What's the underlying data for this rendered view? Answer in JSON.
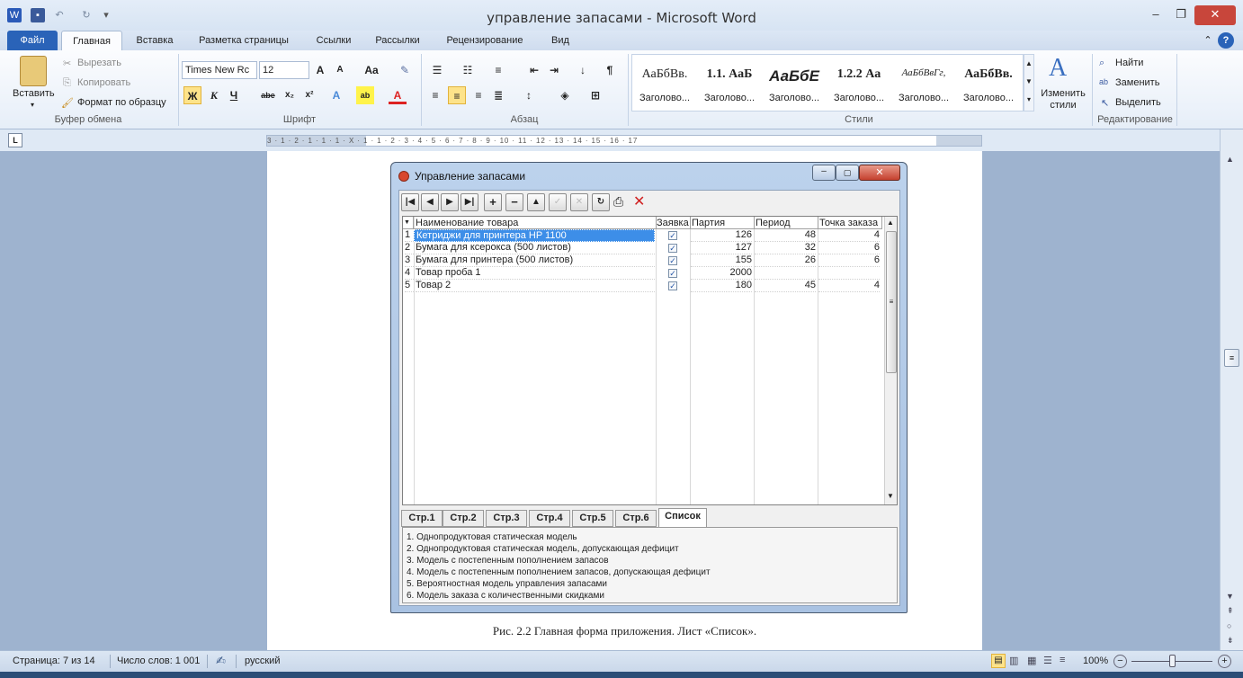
{
  "window": {
    "title": "управление запасами - Microsoft Word"
  },
  "tabs": [
    "Файл",
    "Главная",
    "Вставка",
    "Разметка страницы",
    "Ссылки",
    "Рассылки",
    "Рецензирование",
    "Вид"
  ],
  "clipboard": {
    "paste": "Вставить",
    "cut": "Вырезать",
    "copy": "Копировать",
    "format_painter": "Формат по образцу",
    "label": "Буфер обмена"
  },
  "font": {
    "name": "Times New Rc",
    "size": "12",
    "label": "Шрифт"
  },
  "paragraph": {
    "label": "Абзац"
  },
  "styles": {
    "label": "Стили",
    "items": [
      {
        "preview": "АаБбВв.",
        "name": "Заголово..."
      },
      {
        "preview": "1.1. АаБ",
        "name": "Заголово..."
      },
      {
        "preview": "АаБбЕ",
        "name": "Заголово..."
      },
      {
        "preview": "1.2.2 Аа",
        "name": "Заголово..."
      },
      {
        "preview": "АаБбВвГг,",
        "name": "Заголово..."
      },
      {
        "preview": "АаБбВв.",
        "name": "Заголово..."
      }
    ],
    "change": "Изменить стили"
  },
  "editing": {
    "find": "Найти",
    "replace": "Заменить",
    "select": "Выделить",
    "label": "Редактирование"
  },
  "ruler": {
    "marks": "3 · 1 · 2 · 1 · 1 · 1 · X · 1 · 1 · 2 · 3 · 4 · 5 · 6 · 7 · 8 · 9 · 10 · 11 · 12 · 13 · 14 · 15 · 16 · 17"
  },
  "dialog": {
    "title": "Управление запасами",
    "columns": [
      "Наименование товара",
      "Заявка",
      "Партия",
      "Период",
      "Точка заказа"
    ],
    "rows": [
      {
        "n": "1",
        "name": "Кетриджи для принтера HP 1100",
        "order": true,
        "batch": "126",
        "period": "48",
        "point": "4"
      },
      {
        "n": "2",
        "name": "Бумага для ксерокса (500 листов)",
        "order": true,
        "batch": "127",
        "period": "32",
        "point": "6"
      },
      {
        "n": "3",
        "name": "Бумага для принтера (500 листов)",
        "order": true,
        "batch": "155",
        "period": "26",
        "point": "6"
      },
      {
        "n": "4",
        "name": "Товар проба 1",
        "order": true,
        "batch": "2000",
        "period": "",
        "point": ""
      },
      {
        "n": "5",
        "name": "Товар 2",
        "order": true,
        "batch": "180",
        "period": "45",
        "point": "4"
      }
    ],
    "tabs": [
      "Стр.1",
      "Стр.2",
      "Стр.3",
      "Стр.4",
      "Стр.5",
      "Стр.6",
      "Список"
    ],
    "models": [
      "1. Однопродуктовая статическая модель",
      "2. Однопродуктовая статическая модель, допускающая дефицит",
      "3. Модель с постепенным пополнением запасов",
      "4. Модель с постепенным пополнением запасов, допускающая дефицит",
      "5. Вероятностная модель управления запасами",
      "6. Модель заказа с количественными скидками"
    ]
  },
  "caption": "Рис. 2.2 Главная форма приложения. Лист «Список».",
  "status": {
    "page": "Страница: 7 из 14",
    "words": "Число слов: 1 001",
    "lang": "русский",
    "zoom": "100%"
  }
}
